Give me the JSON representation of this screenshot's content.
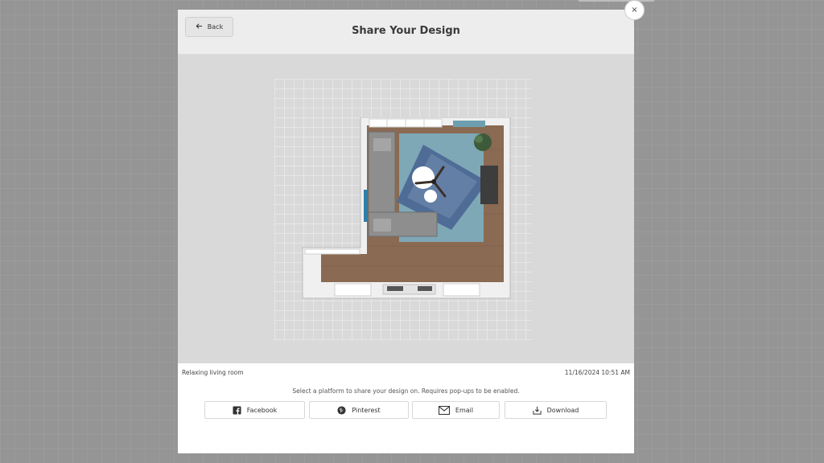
{
  "modal": {
    "title": "Share Your Design",
    "back_label": "Back",
    "close_symbol": "×"
  },
  "design": {
    "name": "Relaxing living room",
    "date": "11/16/2024 10:51 AM"
  },
  "share": {
    "instruction": "Select a platform to share your design on. Requires pop-ups to be enabled.",
    "buttons": [
      {
        "label": "Facebook",
        "icon": "facebook-icon"
      },
      {
        "label": "Pinterest",
        "icon": "pinterest-icon"
      },
      {
        "label": "Email",
        "icon": "envelope-icon"
      },
      {
        "label": "Download",
        "icon": "download-icon"
      }
    ]
  },
  "colors": {
    "overlay": "#959595",
    "header": "#ededed",
    "preview_bg": "#d9d9d9",
    "rug": "#5c7aa3",
    "floor": "#8a6a52"
  }
}
